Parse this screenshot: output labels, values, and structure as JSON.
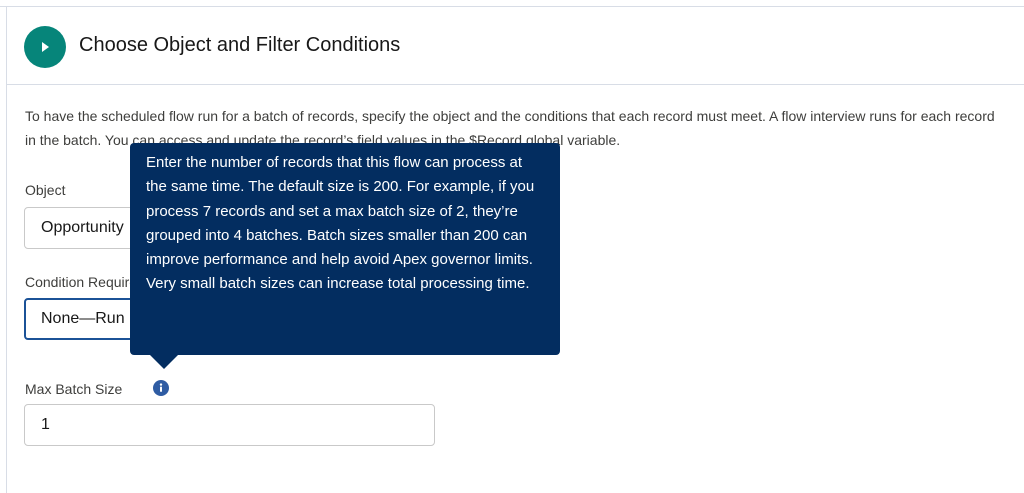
{
  "header": {
    "title": "Choose Object and Filter Conditions",
    "icon": "play-icon",
    "icon_color": "#06857a"
  },
  "description": "To have the scheduled flow run for a batch of records, specify the object and the conditions that each record must meet. A flow interview runs for each record in the batch. You can access and update the record’s field values in the $Record global variable.",
  "object_field": {
    "label": "Object",
    "value": "Opportunity"
  },
  "condition_field": {
    "label": "Condition Requirements",
    "value": "None—Run Flow for All Records"
  },
  "max_batch_field": {
    "label": "Max Batch Size",
    "value": "1",
    "info_icon": "info-icon"
  },
  "tooltip": {
    "text": "Enter the number of records that this flow can process at the same time. The default size is 200. For example, if you process 7 records and set a max batch size of 2, they’re grouped into 4 batches. Batch sizes smaller than 200 can improve performance and help avoid Apex governor limits. Very small batch sizes can increase total processing time.",
    "background": "#032d60"
  }
}
